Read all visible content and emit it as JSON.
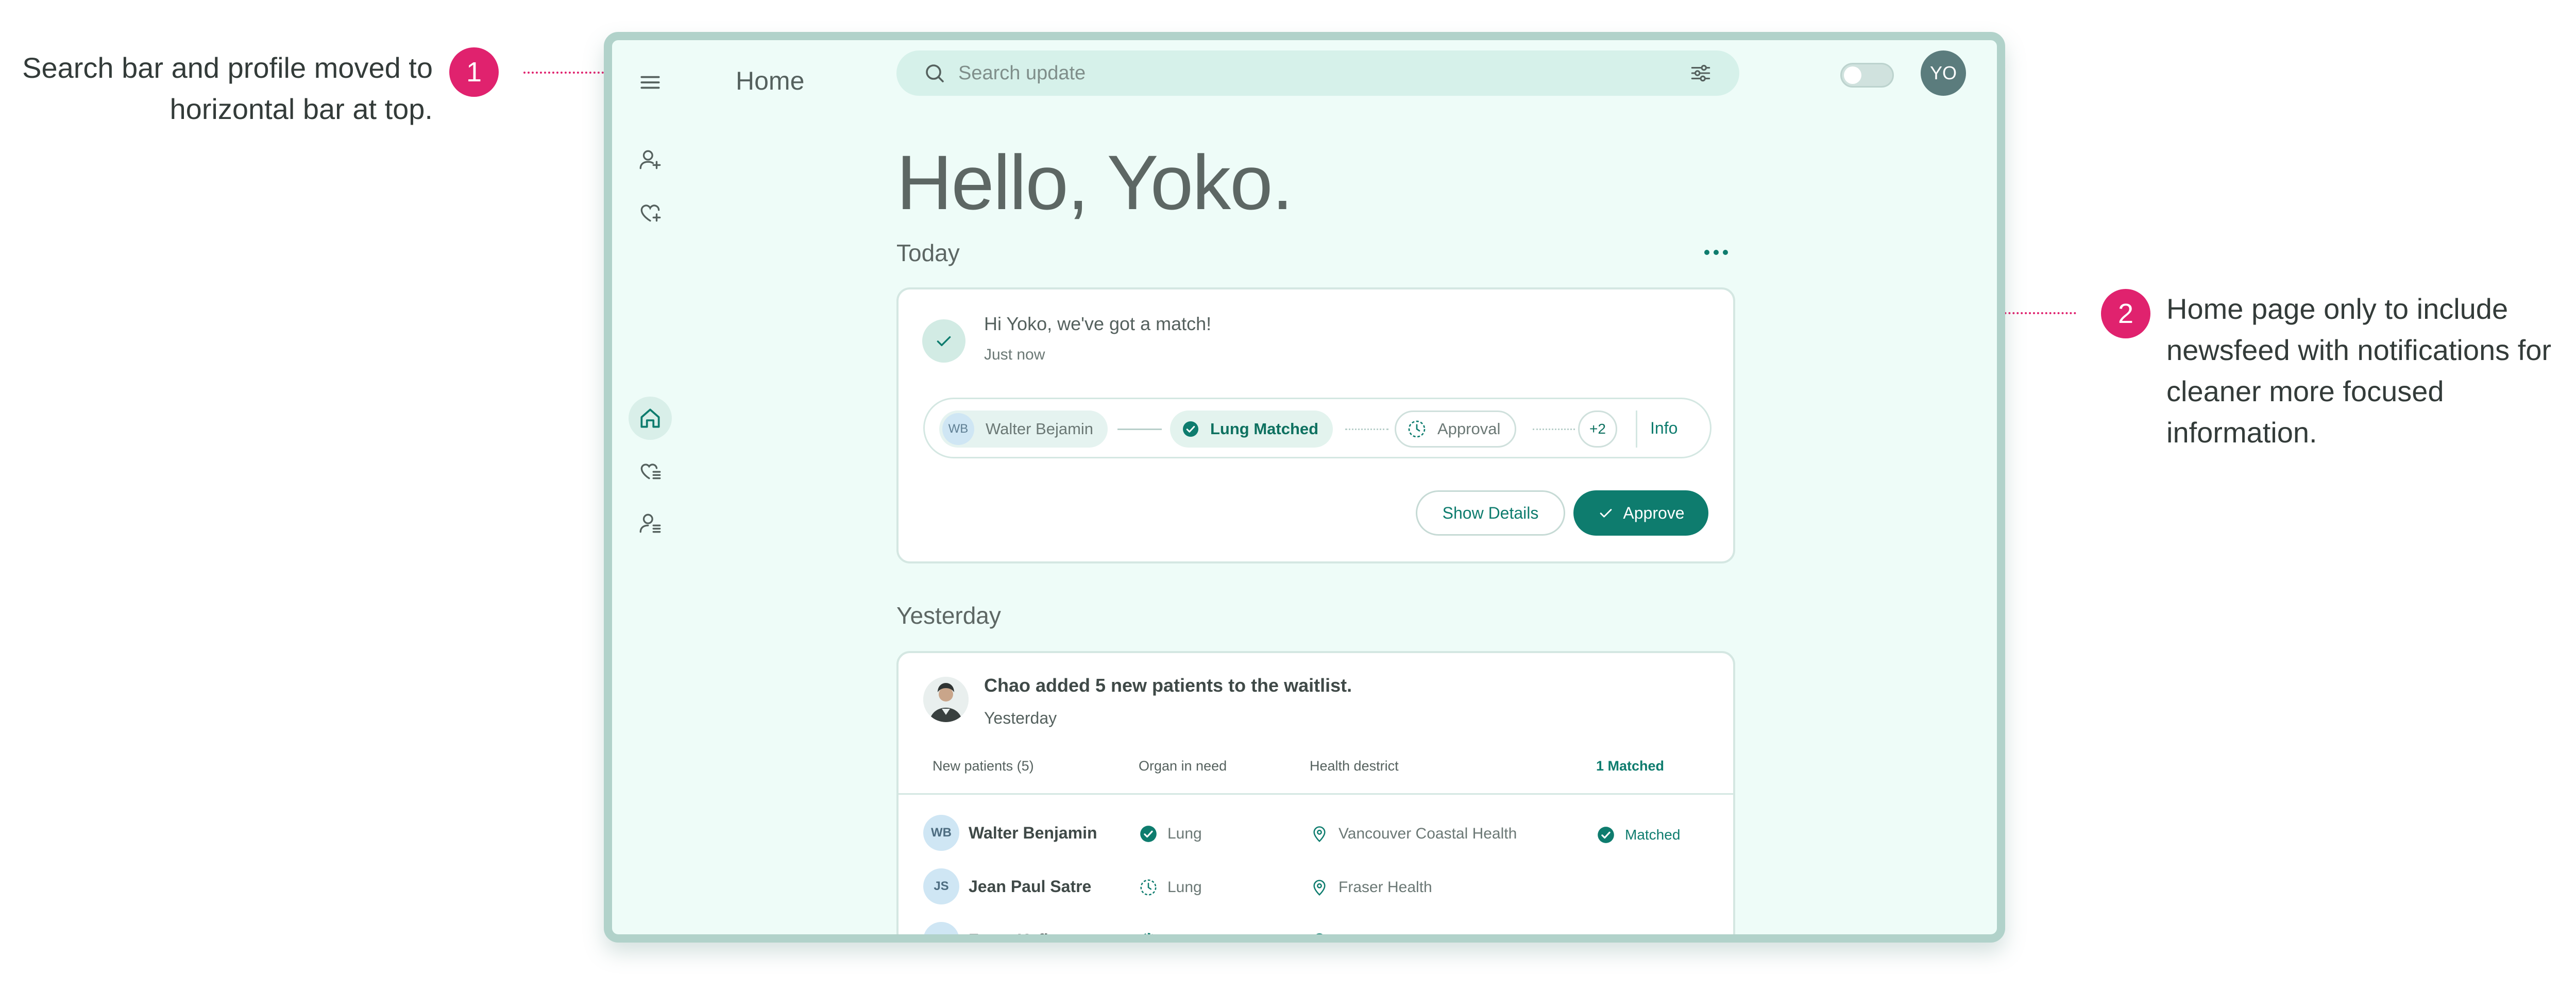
{
  "annotations": [
    {
      "number": "1",
      "text": "Search bar and profile moved to horizontal bar at top."
    },
    {
      "number": "2",
      "text": "Home page only to include newsfeed with notifications for cleaner more focused information."
    }
  ],
  "colors": {
    "accent": "#0e7c6e",
    "annotation": "#e0226e",
    "window_bg": "#eefcf8",
    "frame": "#b1d2ca"
  },
  "nav": {
    "icons": [
      "menu-icon",
      "add-user-icon",
      "add-heart-icon",
      "home-icon",
      "heart-list-icon",
      "user-list-icon"
    ],
    "active": "home"
  },
  "header": {
    "title": "Home",
    "search_placeholder": "Search update",
    "avatar_initials": "YO"
  },
  "greeting": "Hello, Yoko.",
  "today": {
    "heading": "Today",
    "card": {
      "title": "Hi Yoko, we've got a match!",
      "time": "Just now",
      "flow": {
        "patient_initials": "WB",
        "patient_name": "Walter Bejamin",
        "match_label": "Lung Matched",
        "approval_label": "Approval",
        "more_count": "+2",
        "info_label": "Info"
      },
      "show_details_label": "Show Details",
      "approve_label": "Approve"
    }
  },
  "yesterday": {
    "heading": "Yesterday",
    "card": {
      "title": "Chao added 5 new patients to the waitlist.",
      "time": "Yesterday",
      "headers": {
        "name": "New patients (5)",
        "organ": "Organ in need",
        "district": "Health destrict",
        "matched": "1 Matched"
      },
      "rows": [
        {
          "initials": "WB",
          "name": "Walter Benjamin",
          "organ": "Lung",
          "organ_status": "matched",
          "district": "Vancouver Coastal Health",
          "status": "Matched"
        },
        {
          "initials": "JS",
          "name": "Jean Paul Satre",
          "organ": "Lung",
          "organ_status": "pending",
          "district": "Fraser Health",
          "status": ""
        },
        {
          "initials": "FK",
          "name": "Franz Kafka",
          "organ": "Lung",
          "organ_status": "pending",
          "district": "Island Health",
          "status": ""
        }
      ]
    }
  }
}
